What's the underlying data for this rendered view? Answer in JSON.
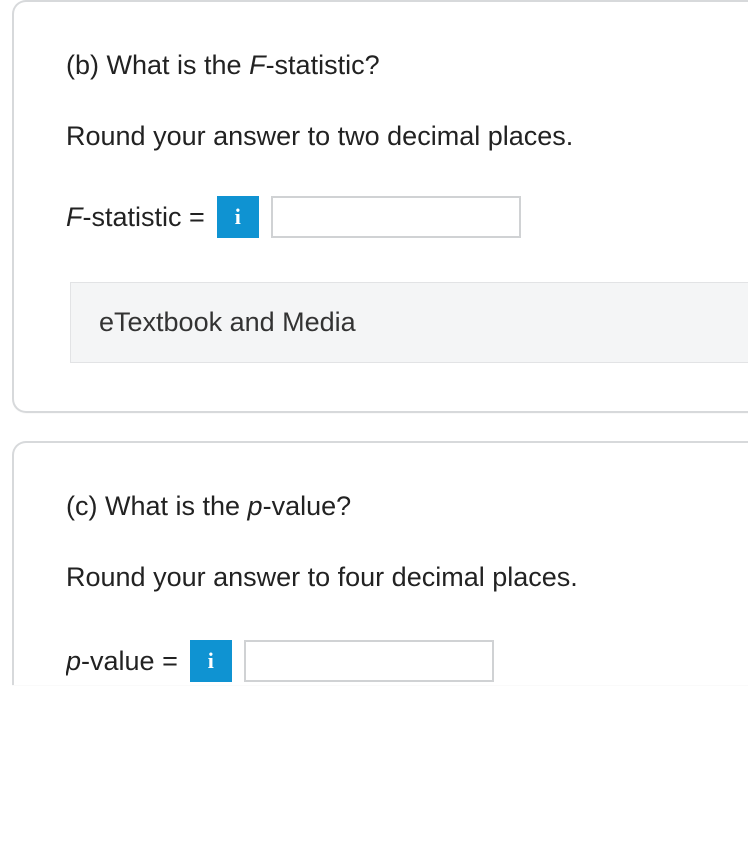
{
  "partB": {
    "question_prefix": "(b) What is the ",
    "question_term": "F",
    "question_suffix": "-statistic?",
    "instruction": "Round your answer to two decimal places.",
    "label_term": "F",
    "label_suffix": "-statistic = ",
    "info_glyph": "i",
    "etextbook_label": "eTextbook and Media"
  },
  "partC": {
    "question_prefix": "(c) What is the ",
    "question_term": "p",
    "question_suffix": "-value?",
    "instruction": "Round your answer to four decimal places.",
    "label_term": "p",
    "label_suffix": "-value = ",
    "info_glyph": "i"
  }
}
